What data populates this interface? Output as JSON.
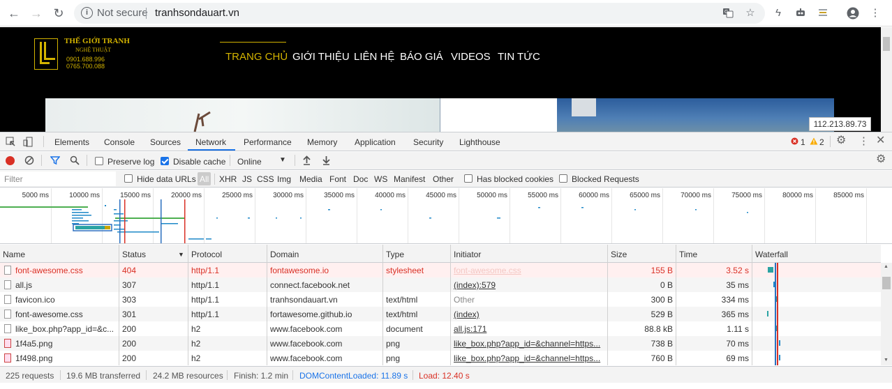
{
  "browser": {
    "security_label": "Not secure",
    "url": "tranhsondauart.vn"
  },
  "site": {
    "logo_line1": "THẾ GIỚI TRANH",
    "logo_line2": "NGHỆ THUẬT",
    "logo_phone1": "0901.688.996",
    "logo_phone2": "0765.700.088",
    "nav": [
      "TRANG CHỦ",
      "GIỚI THIỆU",
      "LIÊN HỆ",
      "BÁO GIÁ",
      "VIDEOS",
      "TIN TỨC"
    ],
    "ip_tooltip": "112.213.89.73"
  },
  "devtools": {
    "tabs": [
      "Elements",
      "Console",
      "Sources",
      "Network",
      "Performance",
      "Memory",
      "Application",
      "Security",
      "Lighthouse"
    ],
    "active_tab": "Network",
    "error_count": "1",
    "warning_count": "2",
    "toolbar": {
      "preserve_log": "Preserve log",
      "disable_cache": "Disable cache",
      "throttling": "Online"
    },
    "filter": {
      "placeholder": "Filter",
      "hide_data_urls": "Hide data URLs",
      "types": [
        "All",
        "XHR",
        "JS",
        "CSS",
        "Img",
        "Media",
        "Font",
        "Doc",
        "WS",
        "Manifest",
        "Other"
      ],
      "has_blocked_cookies": "Has blocked cookies",
      "blocked_requests": "Blocked Requests"
    },
    "overview_ticks": [
      "5000 ms",
      "10000 ms",
      "15000 ms",
      "20000 ms",
      "25000 ms",
      "30000 ms",
      "35000 ms",
      "40000 ms",
      "45000 ms",
      "50000 ms",
      "55000 ms",
      "60000 ms",
      "65000 ms",
      "70000 ms",
      "75000 ms",
      "80000 ms",
      "85000 ms",
      "9"
    ],
    "columns": [
      "Name",
      "Status",
      "Protocol",
      "Domain",
      "Type",
      "Initiator",
      "Size",
      "Time",
      "Waterfall"
    ],
    "rows": [
      {
        "name": "font-awesome.css",
        "status": "404",
        "protocol": "http/1.1",
        "domain": "fontawesome.io",
        "type": "stylesheet",
        "initiator": "font-awesome.css",
        "size": "155 B",
        "time": "3.52 s"
      },
      {
        "name": "all.js",
        "status": "307",
        "protocol": "http/1.1",
        "domain": "connect.facebook.net",
        "type": "",
        "initiator": "(index):579",
        "size": "0 B",
        "time": "35 ms"
      },
      {
        "name": "favicon.ico",
        "status": "303",
        "protocol": "http/1.1",
        "domain": "tranhsondauart.vn",
        "type": "text/html",
        "initiator": "Other",
        "size": "300 B",
        "time": "334 ms"
      },
      {
        "name": "font-awesome.css",
        "status": "301",
        "protocol": "http/1.1",
        "domain": "fortawesome.github.io",
        "type": "text/html",
        "initiator": "(index)",
        "size": "529 B",
        "time": "365 ms"
      },
      {
        "name": "like_box.php?app_id=&c...",
        "status": "200",
        "protocol": "h2",
        "domain": "www.facebook.com",
        "type": "document",
        "initiator": "all.js:171",
        "size": "88.8 kB",
        "time": "1.11 s"
      },
      {
        "name": "1f4a5.png",
        "status": "200",
        "protocol": "h2",
        "domain": "www.facebook.com",
        "type": "png",
        "initiator": "like_box.php?app_id=&channel=https...",
        "size": "738 B",
        "time": "70 ms"
      },
      {
        "name": "1f498.png",
        "status": "200",
        "protocol": "h2",
        "domain": "www.facebook.com",
        "type": "png",
        "initiator": "like_box.php?app_id=&channel=https...",
        "size": "760 B",
        "time": "69 ms"
      }
    ],
    "status": {
      "requests": "225 requests",
      "transferred": "19.6 MB transferred",
      "resources": "24.2 MB resources",
      "finish": "Finish: 1.2 min",
      "dom_loaded": "DOMContentLoaded: 11.89 s",
      "load": "Load: 12.40 s"
    }
  },
  "colors": {
    "accent": "#1a73e8",
    "error": "#d93025",
    "logo_gold": "#d4b400"
  }
}
